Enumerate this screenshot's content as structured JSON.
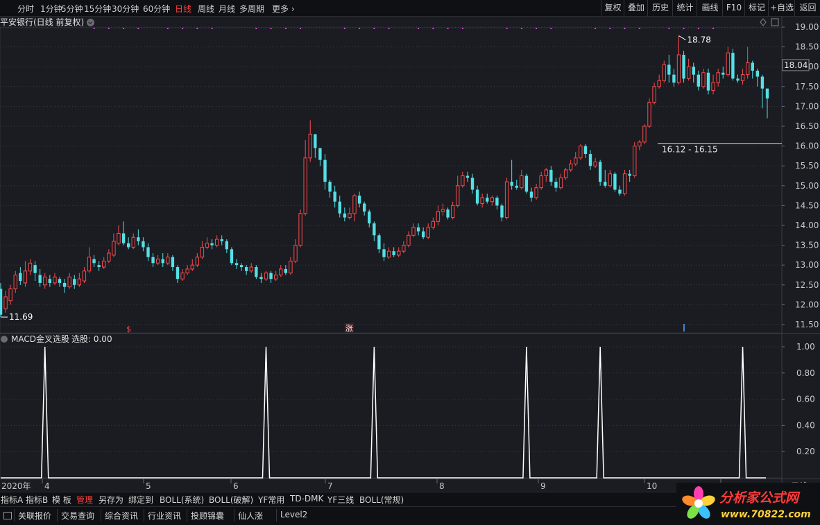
{
  "colors": {
    "up": "#ff4a4a",
    "down": "#54e0e6",
    "accent": "#ff3b3b",
    "orange": "#ff8a2a",
    "signal": "#d04ad0",
    "indicator": "#ffffff"
  },
  "periods": [
    {
      "label": "分时",
      "active": false
    },
    {
      "label": "1分钟",
      "active": false
    },
    {
      "label": "5分钟",
      "active": false
    },
    {
      "label": "15分钟",
      "active": false
    },
    {
      "label": "30分钟",
      "active": false
    },
    {
      "label": "60分钟",
      "active": false
    },
    {
      "label": "日线",
      "active": true
    },
    {
      "label": "周线",
      "active": false
    },
    {
      "label": "月线",
      "active": false
    },
    {
      "label": "多周期",
      "active": false
    },
    {
      "label": "更多",
      "active": false
    }
  ],
  "right_buttons": [
    "复权",
    "叠加",
    "历史",
    "统计",
    "画线",
    "F10",
    "标记",
    "+自选",
    "返回"
  ],
  "stock_title": "平安银行(日线 前复权)",
  "price_axis": [
    "19.00",
    "18.50",
    "18.00",
    "17.50",
    "17.00",
    "16.50",
    "16.00",
    "15.50",
    "15.00",
    "14.50",
    "14.00",
    "13.50",
    "13.00",
    "12.50",
    "12.00",
    "11.50"
  ],
  "current_price": "18.04",
  "annotations": {
    "high": "18.78",
    "low": "11.69",
    "range": "16.12 - 16.15",
    "event_s": "$",
    "event_zhang": "涨"
  },
  "indicator": {
    "title": "MACD金叉选股",
    "value_label": "选股: 0.00",
    "axis": [
      "1.00",
      "0.80",
      "0.60",
      "0.40",
      "0.20"
    ]
  },
  "time_axis": {
    "year": "2020年",
    "months": [
      "4",
      "5",
      "6",
      "7",
      "8",
      "9",
      "10",
      "11"
    ],
    "period_label": "日线"
  },
  "indicator_tabs": [
    "指标A",
    "指标B",
    "模 板",
    "管理",
    "另存为",
    "绑定到",
    "BOLL(系统)",
    "BOLL(破解)",
    "YF常用",
    "TD-DMK",
    "YF三线",
    "BOLL(常规)"
  ],
  "bottom_tabs": [
    "关联报价",
    "交易查询",
    "综合资讯",
    "行业资讯",
    "投顾锦囊",
    "仙人涨",
    "Level2"
  ],
  "watermark": {
    "text": "分析家公式网",
    "url": "www.70822.com"
  },
  "chart_data": {
    "type": "candlestick",
    "series_name": "平安银行(日线 前复权)",
    "ylim": [
      11.4,
      19.1
    ],
    "x_months": [
      "4",
      "5",
      "6",
      "7",
      "8",
      "9",
      "10",
      "11"
    ],
    "candles": [
      [
        12.4,
        11.75,
        12.55,
        11.69
      ],
      [
        11.9,
        12.2,
        12.35,
        11.8
      ],
      [
        12.1,
        12.4,
        12.5,
        12.0
      ],
      [
        12.4,
        12.75,
        12.85,
        12.3
      ],
      [
        12.8,
        12.6,
        12.95,
        12.5
      ],
      [
        12.55,
        12.85,
        13.1,
        12.45
      ],
      [
        12.85,
        13.05,
        13.15,
        12.75
      ],
      [
        13.0,
        12.8,
        13.1,
        12.6
      ],
      [
        12.75,
        12.55,
        12.9,
        12.45
      ],
      [
        12.5,
        12.7,
        12.8,
        12.4
      ],
      [
        12.65,
        12.55,
        12.75,
        12.45
      ],
      [
        12.55,
        12.7,
        12.8,
        12.5
      ],
      [
        12.65,
        12.55,
        12.7,
        12.45
      ],
      [
        12.55,
        12.45,
        12.65,
        12.3
      ],
      [
        12.45,
        12.7,
        12.8,
        12.4
      ],
      [
        12.65,
        12.5,
        12.75,
        12.4
      ],
      [
        12.5,
        12.65,
        12.8,
        12.45
      ],
      [
        12.6,
        12.85,
        12.95,
        12.55
      ],
      [
        12.85,
        13.2,
        13.45,
        12.8
      ],
      [
        13.15,
        13.05,
        13.25,
        12.95
      ],
      [
        13.0,
        12.95,
        13.1,
        12.85
      ],
      [
        12.95,
        13.1,
        13.2,
        12.9
      ],
      [
        13.1,
        13.3,
        13.4,
        13.05
      ],
      [
        13.25,
        13.6,
        13.8,
        13.2
      ],
      [
        13.55,
        13.8,
        14.0,
        13.5
      ],
      [
        13.8,
        13.55,
        14.1,
        13.5
      ],
      [
        13.55,
        13.45,
        13.7,
        13.4
      ],
      [
        13.45,
        13.7,
        13.8,
        13.4
      ],
      [
        13.7,
        13.6,
        13.9,
        13.5
      ],
      [
        13.6,
        13.45,
        13.7,
        13.35
      ],
      [
        13.45,
        13.2,
        13.55,
        13.1
      ],
      [
        13.2,
        13.05,
        13.3,
        12.95
      ],
      [
        13.05,
        13.15,
        13.25,
        13.0
      ],
      [
        13.15,
        13.05,
        13.3,
        12.95
      ],
      [
        13.05,
        13.2,
        13.3,
        13.0
      ],
      [
        13.2,
        12.95,
        13.25,
        12.85
      ],
      [
        12.95,
        12.65,
        13.0,
        12.55
      ],
      [
        12.65,
        12.8,
        12.9,
        12.6
      ],
      [
        12.8,
        12.9,
        13.0,
        12.75
      ],
      [
        12.9,
        13.0,
        13.15,
        12.85
      ],
      [
        13.0,
        13.2,
        13.3,
        12.95
      ],
      [
        13.2,
        13.45,
        13.6,
        13.15
      ],
      [
        13.45,
        13.55,
        13.7,
        13.4
      ],
      [
        13.55,
        13.5,
        13.65,
        13.4
      ],
      [
        13.5,
        13.65,
        13.75,
        13.45
      ],
      [
        13.65,
        13.6,
        13.75,
        13.5
      ],
      [
        13.6,
        13.4,
        13.65,
        13.3
      ],
      [
        13.4,
        13.05,
        13.45,
        13.0
      ],
      [
        13.05,
        13.0,
        13.15,
        12.9
      ],
      [
        13.0,
        12.95,
        13.05,
        12.85
      ],
      [
        12.95,
        12.85,
        13.0,
        12.75
      ],
      [
        12.85,
        12.95,
        13.05,
        12.8
      ],
      [
        12.95,
        12.7,
        13.0,
        12.65
      ],
      [
        12.7,
        12.65,
        12.8,
        12.55
      ],
      [
        12.65,
        12.8,
        12.85,
        12.6
      ],
      [
        12.8,
        12.65,
        12.85,
        12.55
      ],
      [
        12.65,
        12.75,
        12.85,
        12.6
      ],
      [
        12.75,
        12.9,
        13.0,
        12.7
      ],
      [
        12.9,
        12.8,
        13.0,
        12.75
      ],
      [
        12.8,
        13.1,
        13.2,
        12.75
      ],
      [
        13.1,
        13.5,
        13.65,
        13.05
      ],
      [
        13.5,
        14.3,
        14.4,
        13.45
      ],
      [
        14.3,
        15.7,
        16.15,
        14.25
      ],
      [
        15.7,
        16.3,
        16.65,
        15.6
      ],
      [
        16.3,
        15.95,
        16.1,
        15.7
      ],
      [
        15.95,
        15.65,
        15.85,
        15.5
      ],
      [
        15.65,
        15.1,
        15.8,
        14.9
      ],
      [
        15.1,
        14.85,
        15.15,
        14.7
      ],
      [
        14.85,
        14.6,
        15.0,
        14.45
      ],
      [
        14.6,
        14.3,
        14.75,
        14.2
      ],
      [
        14.3,
        14.2,
        14.45,
        14.1
      ],
      [
        14.2,
        14.3,
        14.45,
        14.15
      ],
      [
        14.3,
        14.75,
        14.8,
        14.1
      ],
      [
        14.75,
        14.55,
        14.85,
        14.45
      ],
      [
        14.55,
        14.35,
        14.6,
        14.25
      ],
      [
        14.35,
        14.05,
        14.4,
        13.95
      ],
      [
        14.05,
        13.75,
        14.1,
        13.6
      ],
      [
        13.75,
        13.4,
        13.8,
        13.3
      ],
      [
        13.4,
        13.2,
        13.55,
        13.1
      ],
      [
        13.2,
        13.35,
        13.45,
        13.15
      ],
      [
        13.35,
        13.25,
        13.45,
        13.2
      ],
      [
        13.25,
        13.35,
        13.45,
        13.2
      ],
      [
        13.35,
        13.5,
        13.6,
        13.3
      ],
      [
        13.5,
        13.75,
        13.85,
        13.45
      ],
      [
        13.75,
        13.95,
        14.05,
        13.7
      ],
      [
        13.95,
        13.85,
        14.05,
        13.75
      ],
      [
        13.85,
        13.7,
        13.95,
        13.65
      ],
      [
        13.7,
        13.95,
        14.05,
        13.65
      ],
      [
        13.95,
        14.1,
        14.2,
        13.9
      ],
      [
        14.1,
        14.35,
        14.5,
        14.0
      ],
      [
        14.35,
        14.4,
        14.55,
        14.25
      ],
      [
        14.4,
        14.2,
        14.45,
        14.15
      ],
      [
        14.2,
        14.5,
        14.6,
        14.15
      ],
      [
        14.5,
        15.0,
        15.25,
        14.45
      ],
      [
        15.0,
        15.25,
        15.35,
        14.95
      ],
      [
        15.25,
        15.2,
        15.35,
        15.1
      ],
      [
        15.2,
        14.9,
        15.3,
        14.8
      ],
      [
        14.9,
        14.55,
        15.0,
        14.5
      ],
      [
        14.55,
        14.7,
        14.8,
        14.45
      ],
      [
        14.7,
        14.6,
        14.8,
        14.55
      ],
      [
        14.6,
        14.7,
        14.75,
        14.5
      ],
      [
        14.7,
        14.5,
        14.75,
        14.4
      ],
      [
        14.5,
        14.2,
        14.55,
        14.1
      ],
      [
        14.2,
        15.1,
        15.2,
        14.15
      ],
      [
        15.1,
        15.0,
        15.65,
        14.9
      ],
      [
        15.0,
        14.95,
        15.15,
        14.9
      ],
      [
        14.95,
        15.25,
        15.4,
        14.9
      ],
      [
        15.25,
        14.85,
        15.3,
        14.8
      ],
      [
        14.85,
        14.7,
        14.95,
        14.6
      ],
      [
        14.7,
        14.95,
        15.05,
        14.65
      ],
      [
        14.95,
        15.25,
        15.35,
        14.9
      ],
      [
        15.25,
        15.4,
        15.45,
        15.1
      ],
      [
        15.4,
        15.1,
        15.5,
        15.0
      ],
      [
        15.1,
        14.95,
        15.2,
        14.85
      ],
      [
        14.95,
        15.2,
        15.3,
        14.9
      ],
      [
        15.2,
        15.4,
        15.45,
        15.15
      ],
      [
        15.4,
        15.55,
        15.65,
        15.35
      ],
      [
        15.55,
        15.7,
        15.85,
        15.5
      ],
      [
        15.7,
        16.0,
        16.05,
        15.65
      ],
      [
        16.0,
        15.8,
        16.05,
        15.7
      ],
      [
        15.8,
        15.5,
        15.9,
        15.4
      ],
      [
        15.5,
        15.6,
        15.7,
        15.45
      ],
      [
        15.6,
        15.1,
        15.65,
        15.0
      ],
      [
        15.1,
        15.0,
        15.4,
        14.95
      ],
      [
        15.0,
        15.3,
        15.4,
        14.95
      ],
      [
        15.3,
        14.9,
        15.35,
        14.85
      ],
      [
        14.9,
        14.8,
        15.0,
        14.75
      ],
      [
        14.8,
        15.3,
        15.4,
        14.75
      ],
      [
        15.3,
        15.25,
        15.4,
        15.1
      ],
      [
        15.25,
        16.0,
        16.1,
        15.2
      ],
      [
        16.0,
        16.1,
        16.15,
        15.9
      ],
      [
        16.1,
        16.5,
        16.55,
        16.05
      ],
      [
        16.5,
        17.1,
        17.2,
        16.45
      ],
      [
        17.1,
        17.5,
        17.6,
        17.05
      ],
      [
        17.5,
        17.65,
        17.8,
        17.45
      ],
      [
        17.65,
        18.05,
        18.15,
        17.6
      ],
      [
        18.05,
        17.8,
        18.3,
        17.6
      ],
      [
        17.8,
        17.6,
        17.95,
        17.5
      ],
      [
        17.6,
        18.3,
        18.78,
        17.55
      ],
      [
        18.3,
        17.7,
        18.4,
        17.6
      ],
      [
        17.7,
        18.0,
        18.2,
        17.65
      ],
      [
        18.0,
        17.8,
        18.1,
        17.6
      ],
      [
        17.8,
        17.5,
        17.9,
        17.4
      ],
      [
        17.5,
        17.85,
        17.95,
        17.45
      ],
      [
        17.85,
        17.4,
        17.95,
        17.3
      ],
      [
        17.4,
        17.6,
        17.8,
        17.3
      ],
      [
        17.6,
        17.85,
        17.95,
        17.5
      ],
      [
        17.85,
        17.8,
        18.0,
        17.7
      ],
      [
        17.8,
        18.35,
        18.5,
        17.75
      ],
      [
        18.35,
        17.7,
        18.45,
        17.65
      ],
      [
        17.7,
        17.65,
        17.8,
        17.6
      ],
      [
        17.65,
        17.8,
        17.95,
        17.55
      ],
      [
        17.8,
        18.1,
        18.5,
        17.7
      ],
      [
        18.1,
        17.9,
        18.15,
        17.7
      ],
      [
        17.9,
        17.75,
        17.95,
        17.5
      ],
      [
        17.75,
        17.45,
        17.8,
        16.95
      ],
      [
        17.45,
        17.2,
        17.45,
        16.7
      ]
    ],
    "signals": [
      {
        "name": "MACD金叉选股",
        "values": "spikes",
        "peaks": [
          1.0,
          1.0,
          1.0,
          1.0,
          1.0,
          1.0
        ]
      }
    ]
  }
}
